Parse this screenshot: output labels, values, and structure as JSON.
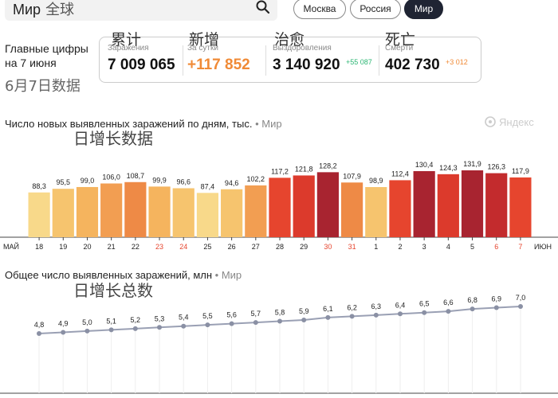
{
  "search": {
    "text": "Мир",
    "text_cn": "全球"
  },
  "region_pills": [
    {
      "label": "Москва",
      "active": false
    },
    {
      "label": "Россия",
      "active": false
    },
    {
      "label": "Мир",
      "active": true
    }
  ],
  "summary": {
    "label_line1": "Главные цифры",
    "label_line2": "на 7 июня",
    "label_cn": "6月7日数据",
    "stats": [
      {
        "caption": "Заражения",
        "value": "7 009 065",
        "delta": "",
        "overlay_cn": "累计",
        "value_color": "#111111"
      },
      {
        "caption": "За сутки",
        "value": "+117 852",
        "delta": "",
        "overlay_cn": "新增",
        "value_color": "#f08a36"
      },
      {
        "caption": "Выздоровления",
        "value": "3 140 920",
        "delta": "+55 087",
        "overlay_cn": "治愈",
        "delta_color": "#2bb673"
      },
      {
        "caption": "Смерти",
        "value": "402 730",
        "delta": "+3 012",
        "overlay_cn": "死亡",
        "delta_color": "#f08a36"
      }
    ]
  },
  "daily": {
    "title": "Число новых выявленных заражений по дням, тыс.",
    "subtitle": "• Мир",
    "overlay_cn": "日增长数据",
    "brand": "Яндекс"
  },
  "total": {
    "title": "Общее число выявленных заражений, млн",
    "subtitle": "• Мир",
    "overlay_cn": "日增长总数"
  },
  "chart_data": [
    {
      "type": "bar",
      "title": "Число новых выявленных заражений по дням, тыс.",
      "x_start_label": "МАЙ",
      "x_end_label": "ИЮН",
      "categories": [
        "18",
        "19",
        "20",
        "21",
        "22",
        "23",
        "24",
        "25",
        "26",
        "27",
        "28",
        "29",
        "30",
        "31",
        "1",
        "2",
        "3",
        "4",
        "5",
        "6",
        "7"
      ],
      "weekend_days": [
        "23",
        "24",
        "30",
        "31",
        "6",
        "7"
      ],
      "values": [
        88.3,
        95.5,
        99.0,
        106.0,
        108.7,
        99.9,
        96.6,
        87.4,
        94.6,
        102.2,
        117.2,
        121.8,
        128.2,
        107.9,
        98.9,
        112.4,
        130.4,
        124.3,
        131.9,
        126.3,
        117.9
      ],
      "value_labels": [
        "88,3",
        "95,5",
        "99,0",
        "106,0",
        "108,7",
        "99,9",
        "96,6",
        "87,4",
        "94,6",
        "102,2",
        "117,2",
        "121,8",
        "128,2",
        "107,9",
        "98,9",
        "112,4",
        "130,4",
        "124,3",
        "131,9",
        "126,3",
        "117,9"
      ],
      "colors": [
        "#f8d98a",
        "#f6c46e",
        "#f5b45e",
        "#f29e52",
        "#ee8a46",
        "#f5b45e",
        "#f6c46e",
        "#f8d98a",
        "#f6c46e",
        "#f29e52",
        "#e6452e",
        "#dc3a2c",
        "#a82430",
        "#ee8a46",
        "#f6c46e",
        "#e6452e",
        "#a82430",
        "#dc3a2c",
        "#a82430",
        "#c32b2d",
        "#e6452e"
      ],
      "weekend_color": "#e6452e"
    },
    {
      "type": "line",
      "title": "Общее число выявленных заражений, млн",
      "categories": [
        "18",
        "19",
        "20",
        "21",
        "22",
        "23",
        "24",
        "25",
        "26",
        "27",
        "28",
        "29",
        "30",
        "31",
        "1",
        "2",
        "3",
        "4",
        "5",
        "6",
        "7"
      ],
      "values": [
        4.8,
        4.9,
        5.0,
        5.1,
        5.2,
        5.3,
        5.4,
        5.5,
        5.6,
        5.7,
        5.8,
        5.9,
        6.1,
        6.2,
        6.3,
        6.4,
        6.5,
        6.6,
        6.8,
        6.9,
        7.0
      ],
      "value_labels": [
        "4,8",
        "4,9",
        "5,0",
        "5,1",
        "5,2",
        "5,3",
        "5,4",
        "5,5",
        "5,6",
        "5,7",
        "5,8",
        "5,9",
        "6,1",
        "6,2",
        "6,3",
        "6,4",
        "6,5",
        "6,6",
        "6,8",
        "6,9",
        "7,0"
      ],
      "line_color": "#9aa0b4",
      "point_color": "#8a90a4"
    }
  ]
}
